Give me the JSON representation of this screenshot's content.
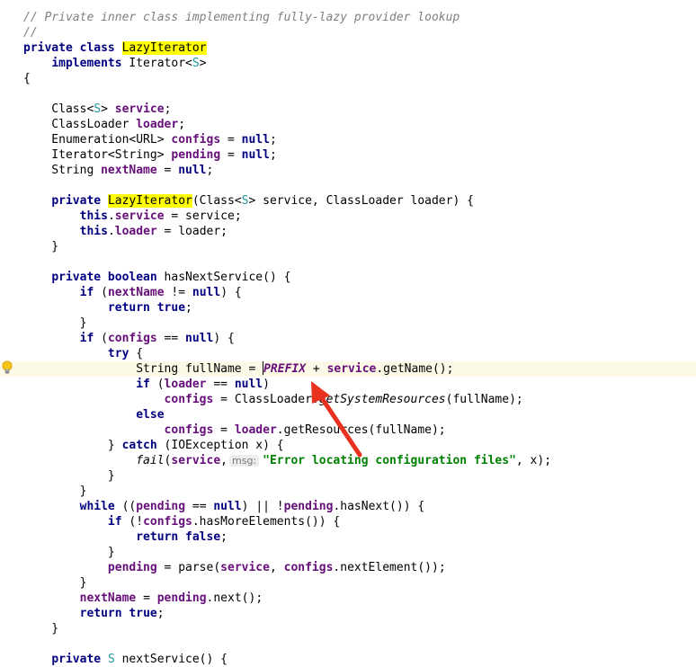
{
  "editor": {
    "highlight_color": "#ffff00",
    "current_line_color": "#fcfae7",
    "annotation_arrow_color": "#e8321e",
    "lines": [
      [
        {
          "t": "// Private inner class implementing fully-lazy provider lookup",
          "c": "comment"
        }
      ],
      [
        {
          "t": "//",
          "c": "comment"
        }
      ],
      [
        {
          "t": "private class ",
          "c": "kw"
        },
        {
          "t": "LazyIterator",
          "c": "hl"
        }
      ],
      [
        {
          "t": "    "
        },
        {
          "t": "implements ",
          "c": "kw"
        },
        {
          "t": "Iterator<"
        },
        {
          "t": "S",
          "c": "generic"
        },
        {
          "t": ">"
        }
      ],
      [
        {
          "t": "{"
        }
      ],
      [],
      [
        {
          "t": "    Class<"
        },
        {
          "t": "S",
          "c": "generic"
        },
        {
          "t": "> "
        },
        {
          "t": "service",
          "c": "field"
        },
        {
          "t": ";"
        }
      ],
      [
        {
          "t": "    ClassLoader "
        },
        {
          "t": "loader",
          "c": "field"
        },
        {
          "t": ";"
        }
      ],
      [
        {
          "t": "    Enumeration<URL> "
        },
        {
          "t": "configs",
          "c": "field"
        },
        {
          "t": " = "
        },
        {
          "t": "null",
          "c": "kw"
        },
        {
          "t": ";"
        }
      ],
      [
        {
          "t": "    Iterator<String> "
        },
        {
          "t": "pending",
          "c": "field"
        },
        {
          "t": " = "
        },
        {
          "t": "null",
          "c": "kw"
        },
        {
          "t": ";"
        }
      ],
      [
        {
          "t": "    String "
        },
        {
          "t": "nextName",
          "c": "field"
        },
        {
          "t": " = "
        },
        {
          "t": "null",
          "c": "kw"
        },
        {
          "t": ";"
        }
      ],
      [],
      [
        {
          "t": "    "
        },
        {
          "t": "private ",
          "c": "kw"
        },
        {
          "t": "LazyIterator",
          "c": "hl"
        },
        {
          "t": "(Class<"
        },
        {
          "t": "S",
          "c": "generic"
        },
        {
          "t": "> service, ClassLoader loader) {"
        }
      ],
      [
        {
          "t": "        "
        },
        {
          "t": "this",
          "c": "kw"
        },
        {
          "t": "."
        },
        {
          "t": "service",
          "c": "field"
        },
        {
          "t": " = service;"
        }
      ],
      [
        {
          "t": "        "
        },
        {
          "t": "this",
          "c": "kw"
        },
        {
          "t": "."
        },
        {
          "t": "loader",
          "c": "field"
        },
        {
          "t": " = loader;"
        }
      ],
      [
        {
          "t": "    }"
        }
      ],
      [],
      [
        {
          "t": "    "
        },
        {
          "t": "private boolean ",
          "c": "kw"
        },
        {
          "t": "hasNextService() {"
        }
      ],
      [
        {
          "t": "        "
        },
        {
          "t": "if ",
          "c": "kw"
        },
        {
          "t": "("
        },
        {
          "t": "nextName",
          "c": "field"
        },
        {
          "t": " != "
        },
        {
          "t": "null",
          "c": "kw"
        },
        {
          "t": ") {"
        }
      ],
      [
        {
          "t": "            "
        },
        {
          "t": "return true",
          "c": "kw"
        },
        {
          "t": ";"
        }
      ],
      [
        {
          "t": "        }"
        }
      ],
      [
        {
          "t": "        "
        },
        {
          "t": "if ",
          "c": "kw"
        },
        {
          "t": "("
        },
        {
          "t": "configs",
          "c": "field"
        },
        {
          "t": " == "
        },
        {
          "t": "null",
          "c": "kw"
        },
        {
          "t": ") {"
        }
      ],
      [
        {
          "t": "            "
        },
        {
          "t": "try ",
          "c": "kw"
        },
        {
          "t": "{"
        }
      ],
      [
        {
          "t": "                String fullName = "
        },
        {
          "t": "",
          "c": "caret"
        },
        {
          "t": "PREFIX",
          "c": "static-field"
        },
        {
          "t": " + "
        },
        {
          "t": "service",
          "c": "field"
        },
        {
          "t": ".getName();"
        }
      ],
      [
        {
          "t": "                "
        },
        {
          "t": "if ",
          "c": "kw"
        },
        {
          "t": "("
        },
        {
          "t": "loader",
          "c": "field"
        },
        {
          "t": " == "
        },
        {
          "t": "null",
          "c": "kw"
        },
        {
          "t": ")"
        }
      ],
      [
        {
          "t": "                    "
        },
        {
          "t": "configs",
          "c": "field"
        },
        {
          "t": " = ClassLoader."
        },
        {
          "t": "getSystemResources",
          "c": "static-call"
        },
        {
          "t": "(fullName);"
        }
      ],
      [
        {
          "t": "                "
        },
        {
          "t": "else",
          "c": "kw"
        }
      ],
      [
        {
          "t": "                    "
        },
        {
          "t": "configs",
          "c": "field"
        },
        {
          "t": " = "
        },
        {
          "t": "loader",
          "c": "field"
        },
        {
          "t": ".getResources(fullName);"
        }
      ],
      [
        {
          "t": "            } "
        },
        {
          "t": "catch ",
          "c": "kw"
        },
        {
          "t": "(IOException x) {"
        }
      ],
      [
        {
          "t": "                "
        },
        {
          "t": "fail",
          "c": "static-call"
        },
        {
          "t": "("
        },
        {
          "t": "service",
          "c": "field"
        },
        {
          "t": ","
        },
        {
          "t": "msg:",
          "c": "hint"
        },
        {
          "t": "\"Error locating configuration files\"",
          "c": "str"
        },
        {
          "t": ", x);"
        }
      ],
      [
        {
          "t": "            }"
        }
      ],
      [
        {
          "t": "        }"
        }
      ],
      [
        {
          "t": "        "
        },
        {
          "t": "while ",
          "c": "kw"
        },
        {
          "t": "(("
        },
        {
          "t": "pending",
          "c": "field"
        },
        {
          "t": " == "
        },
        {
          "t": "null",
          "c": "kw"
        },
        {
          "t": ") || !"
        },
        {
          "t": "pending",
          "c": "field"
        },
        {
          "t": ".hasNext()) {"
        }
      ],
      [
        {
          "t": "            "
        },
        {
          "t": "if ",
          "c": "kw"
        },
        {
          "t": "(!"
        },
        {
          "t": "configs",
          "c": "field"
        },
        {
          "t": ".hasMoreElements()) {"
        }
      ],
      [
        {
          "t": "                "
        },
        {
          "t": "return false",
          "c": "kw"
        },
        {
          "t": ";"
        }
      ],
      [
        {
          "t": "            }"
        }
      ],
      [
        {
          "t": "            "
        },
        {
          "t": "pending",
          "c": "field"
        },
        {
          "t": " = parse("
        },
        {
          "t": "service",
          "c": "field"
        },
        {
          "t": ", "
        },
        {
          "t": "configs",
          "c": "field"
        },
        {
          "t": ".nextElement());"
        }
      ],
      [
        {
          "t": "        }"
        }
      ],
      [
        {
          "t": "        "
        },
        {
          "t": "nextName",
          "c": "field"
        },
        {
          "t": " = "
        },
        {
          "t": "pending",
          "c": "field"
        },
        {
          "t": ".next();"
        }
      ],
      [
        {
          "t": "        "
        },
        {
          "t": "return true",
          "c": "kw"
        },
        {
          "t": ";"
        }
      ],
      [
        {
          "t": "    }"
        }
      ],
      [],
      [
        {
          "t": "    "
        },
        {
          "t": "private ",
          "c": "kw"
        },
        {
          "t": "S",
          "c": "generic"
        },
        {
          "t": " nextService() {"
        }
      ]
    ]
  }
}
